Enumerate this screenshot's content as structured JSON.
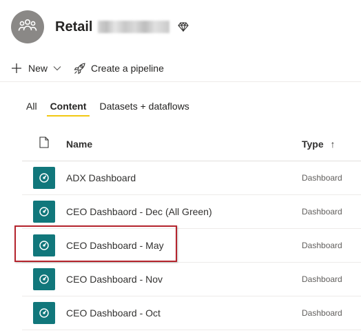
{
  "workspace": {
    "name": "Retail",
    "name_suffix_hidden": true,
    "avatar_icon": "group-icon",
    "premium_icon": "diamond-icon"
  },
  "toolbar": {
    "new_label": "New",
    "pipeline_label": "Create a pipeline"
  },
  "tabs": [
    {
      "label": "All",
      "active": false
    },
    {
      "label": "Content",
      "active": true
    },
    {
      "label": "Datasets + dataflows",
      "active": false
    }
  ],
  "table": {
    "columns": {
      "name": "Name",
      "type": "Type",
      "sort_indicator": "↑"
    },
    "rows": [
      {
        "name": "ADX Dashboard",
        "type": "Dashboard"
      },
      {
        "name": "CEO Dashbaord - Dec (All Green)",
        "type": "Dashboard"
      },
      {
        "name": "CEO Dashboard - May",
        "type": "Dashboard"
      },
      {
        "name": "CEO Dashboard - Nov",
        "type": "Dashboard"
      },
      {
        "name": "CEO Dashboard - Oct",
        "type": "Dashboard"
      }
    ]
  },
  "colors": {
    "accent": "#f2c811",
    "dashboard_tile": "#11777b",
    "highlight": "#b4232c"
  }
}
